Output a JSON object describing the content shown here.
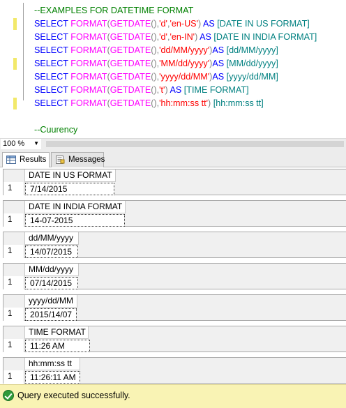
{
  "editor": {
    "lines": [
      {
        "type": "comment",
        "text": "--EXAMPLES FOR DATETIME FORMAT"
      },
      {
        "type": "select",
        "fmt": "'d'",
        "culture": ",'en-US'",
        "space_before_as": true,
        "alias": "[DATE IN US FORMAT]"
      },
      {
        "type": "select",
        "fmt": "'d'",
        "culture": ",'en-IN'",
        "space_before_as": true,
        "alias": "[DATE IN INDIA FORMAT]"
      },
      {
        "type": "select",
        "fmt": "'dd/MM/yyyy'",
        "culture": "",
        "space_before_as": false,
        "alias": "[dd/MM/yyyy]"
      },
      {
        "type": "select",
        "fmt": "'MM/dd/yyyy'",
        "culture": "",
        "space_before_as": false,
        "alias": "[MM/dd/yyyy]"
      },
      {
        "type": "select",
        "fmt": "'yyyy/dd/MM'",
        "culture": "",
        "space_before_as": false,
        "alias": "[yyyy/dd/MM]"
      },
      {
        "type": "select",
        "fmt": "'t'",
        "culture": "",
        "space_before_as": true,
        "alias": "[TIME FORMAT]"
      },
      {
        "type": "select",
        "fmt": "'hh:mm:ss tt'",
        "culture": "",
        "space_before_as": true,
        "alias": "[hh:mm:ss tt]",
        "no_as": true
      },
      {
        "type": "blank",
        "text": ""
      },
      {
        "type": "comment",
        "text": "--Cuurency"
      }
    ],
    "tokens": {
      "select": "SELECT",
      "format": "FORMAT",
      "getdate": "GETDATE",
      "as": "AS"
    }
  },
  "zoom": {
    "value": "100 %"
  },
  "tabs": [
    {
      "label": "Results",
      "active": true,
      "icon": "grid-icon"
    },
    {
      "label": "Messages",
      "active": false,
      "icon": "messages-icon"
    }
  ],
  "results": [
    {
      "header": "DATE IN US FORMAT",
      "row": "1",
      "value": "7/14/2015"
    },
    {
      "header": "DATE IN INDIA FORMAT",
      "row": "1",
      "value": "14-07-2015"
    },
    {
      "header": "dd/MM/yyyy",
      "row": "1",
      "value": "14/07/2015"
    },
    {
      "header": "MM/dd/yyyy",
      "row": "1",
      "value": "07/14/2015"
    },
    {
      "header": "yyyy/dd/MM",
      "row": "1",
      "value": "2015/14/07"
    },
    {
      "header": "TIME FORMAT",
      "row": "1",
      "value": "11:26 AM"
    },
    {
      "header": "hh:mm:ss tt",
      "row": "1",
      "value": "11:26:11 AM"
    }
  ],
  "status": {
    "message": "Query executed successfully.",
    "icon": "success-check-icon",
    "color": "#f9f3b4"
  },
  "colors": {
    "keyword": "#0000ff",
    "function": "#ff00ff",
    "string": "#ff0000",
    "identifier": "#008080",
    "comment": "#008000"
  }
}
